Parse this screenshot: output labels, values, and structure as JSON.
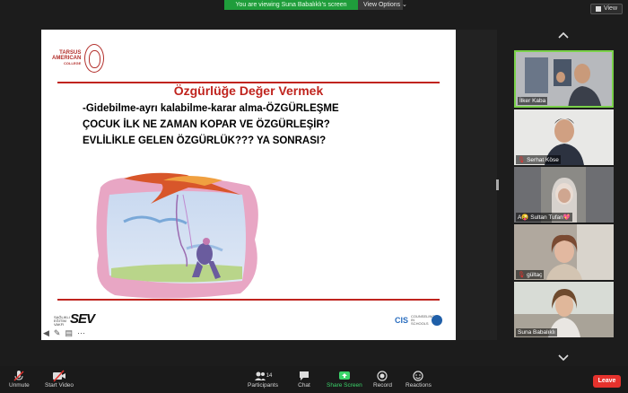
{
  "banner": {
    "sharing_text": "You are viewing Suna Babalıklı's screen",
    "view_options": "View Options ⌄",
    "view": "View"
  },
  "slide": {
    "logo_lines": [
      "TARSUS",
      "AMERICAN",
      "COLLEGE"
    ],
    "title": "Özgürlüğe Değer Vermek",
    "lines": [
      "-Gidebilme-ayrı kalabilme-karar alma-ÖZGÜRLEŞME",
      "ÇOCUK İLK NE ZAMAN KOPAR VE ÖZGÜRLEŞİR?",
      "EVLİLİKLE GELEN ÖZGÜRLÜK??? YA SONRASI?"
    ],
    "footer_left": "SEV",
    "footer_left_small": "SAĞLIKLI EĞİTİM VAKFI",
    "footer_right": "CIS",
    "footer_right_small": "COUNSELING IN SCHOOLS"
  },
  "participants": [
    {
      "name": "İlker Kaba",
      "active": true
    },
    {
      "name": "Serhat Köse",
      "muted": true
    },
    {
      "name": "A😜 Sultan Tufan💖",
      "muted": false
    },
    {
      "name": "gültaç",
      "muted": true
    },
    {
      "name": "Suna Babalıklı",
      "muted": false
    }
  ],
  "toolbar": {
    "unmute": "Unmute",
    "start_video": "Start Video",
    "participants": "Participants",
    "participants_count": "14",
    "chat": "Chat",
    "share_screen": "Share Screen",
    "record": "Record",
    "reactions": "Reactions",
    "leave": "Leave"
  },
  "colors": {
    "share_green": "#1f9d3b",
    "slide_red": "#c0241e",
    "leave_red": "#e5322d",
    "active_speaker": "#7ad14a"
  }
}
